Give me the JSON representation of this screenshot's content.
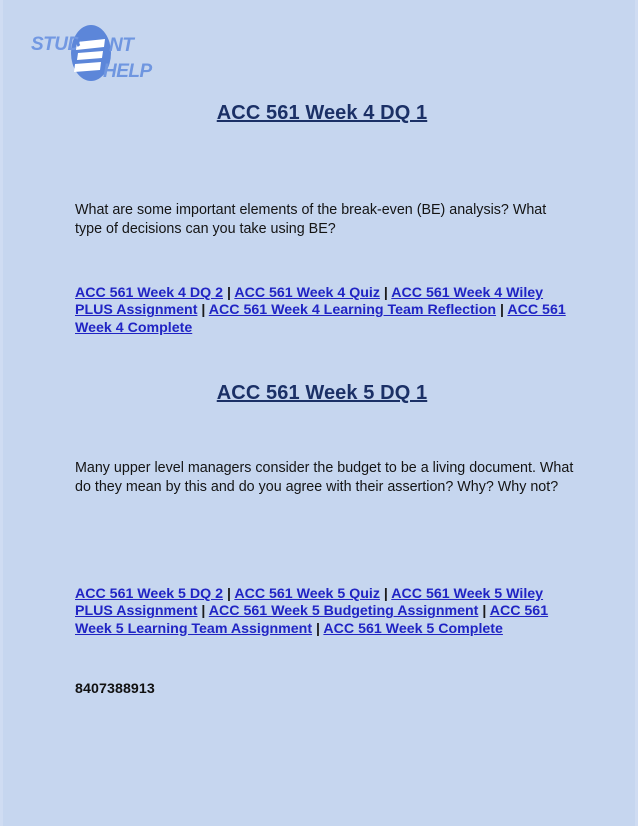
{
  "document": {
    "background_color": "#c6d6ef",
    "title_color": "#1b3066",
    "link_color": "#2024c4",
    "text_color": "#141414"
  },
  "logo": {
    "name": "student-help-logo",
    "text_left": "STUD",
    "text_right_top": "NT",
    "text_right_bottom": "HELP",
    "badge_glyph": "E",
    "badge_color": "#5c86d9",
    "word_color": "#6f96e0"
  },
  "sections": [
    {
      "title": "ACC 561 Week 4 DQ 1",
      "body": "What are some important elements of the break-even (BE) analysis? What type of decisions can you take using BE?",
      "links": [
        "ACC 561 Week 4 DQ 2",
        "ACC 561 Week 4 Quiz",
        "ACC 561 Week 4 Wiley PLUS Assignment",
        "ACC 561 Week 4 Learning Team Reflection",
        "ACC 561 Week 4 Complete"
      ]
    },
    {
      "title": "ACC 561 Week 5 DQ 1",
      "body": "Many upper level managers consider the budget to be a living document. What do they mean by this and do you agree with their assertion?  Why? Why not?",
      "links": [
        "ACC 561 Week 5 DQ 2",
        "ACC 561 Week 5 Quiz",
        "ACC 561 Week 5 Wiley PLUS Assignment",
        "ACC 561 Week 5 Budgeting Assignment",
        "ACC 561 Week 5 Learning Team Assignment",
        "ACC 561 Week 5 Complete"
      ]
    }
  ],
  "link_separator": " | ",
  "footer": {
    "phone": "8407388913"
  }
}
